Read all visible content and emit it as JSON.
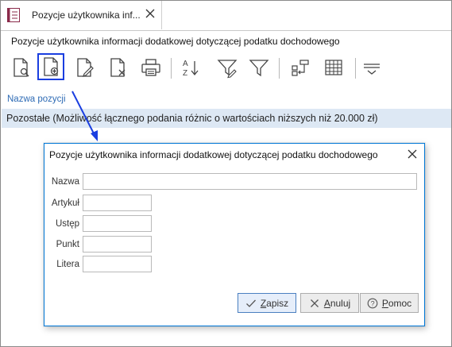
{
  "tab": {
    "title": "Pozycje użytkownika inf..."
  },
  "header": {
    "title": "Pozycje użytkownika informacji dodatkowej dotyczącej podatku dochodowego"
  },
  "toolbar": {
    "buttons": [
      {
        "icon": "preview-document-icon",
        "active": false
      },
      {
        "icon": "add-document-icon",
        "active": true
      },
      {
        "icon": "edit-document-icon",
        "active": false
      },
      {
        "icon": "delete-document-icon",
        "active": false
      },
      {
        "icon": "printer-icon",
        "active": false
      },
      {
        "icon": "sort-az-icon",
        "active": false
      },
      {
        "icon": "filter-edit-icon",
        "active": false
      },
      {
        "icon": "filter-icon",
        "active": false
      },
      {
        "icon": "group-columns-icon",
        "active": false
      },
      {
        "icon": "grid-icon",
        "active": false
      },
      {
        "icon": "more-menu-icon",
        "active": false
      }
    ]
  },
  "list": {
    "column_header": "Nazwa pozycji",
    "rows": [
      "Pozostałe (Możliwość łącznego podania różnic o wartościach niższych niż 20.000 zł)"
    ]
  },
  "dialog": {
    "title": "Pozycje użytkownika informacji dodatkowej dotyczącej podatku dochodowego",
    "fields": [
      {
        "label": "Nazwa",
        "value": ""
      },
      {
        "label": "Artykuł",
        "value": ""
      },
      {
        "label": "Ustęp",
        "value": ""
      },
      {
        "label": "Punkt",
        "value": ""
      },
      {
        "label": "Litera",
        "value": ""
      }
    ],
    "buttons": {
      "save": {
        "label_hot": "Z",
        "label_rest": "apisz"
      },
      "cancel": {
        "label_hot": "A",
        "label_rest": "nuluj"
      },
      "help": {
        "label_hot": "P",
        "label_rest": "omoc"
      }
    }
  },
  "colors": {
    "accent": "#1a3ee0",
    "selection": "#dde8f4",
    "link": "#2e6bb5",
    "dialog_border": "#0078d7"
  }
}
